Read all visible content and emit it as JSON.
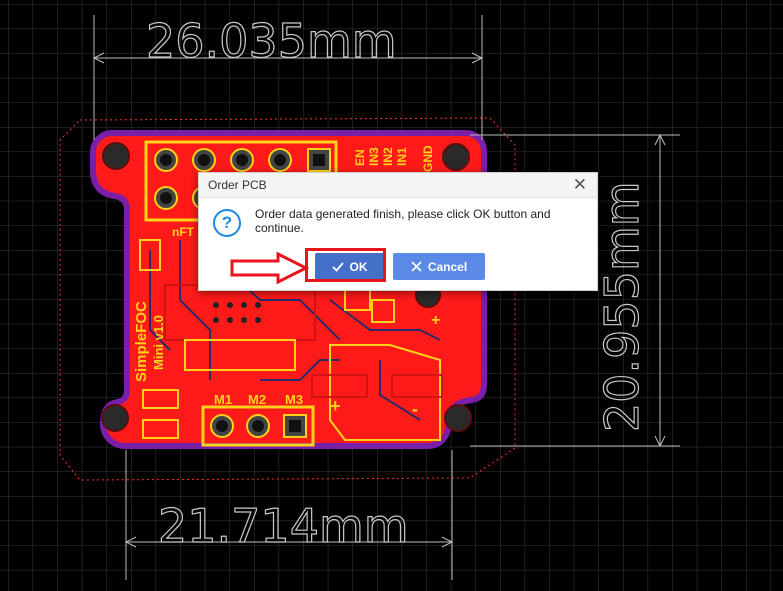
{
  "dimensions": {
    "top_width": "26.035mm",
    "bottom_width": "21.714mm",
    "right_height": "20.955mm"
  },
  "board": {
    "header_labels": [
      "EN",
      "IN3",
      "IN2",
      "IN1",
      "GND"
    ],
    "motor_labels": [
      "M1",
      "M2",
      "M3"
    ],
    "brand_line1": "SimpleFOC",
    "brand_line2": "Mini v1.0",
    "nfault_label": "nFT",
    "plus_sign": "+",
    "minus_sign": "-"
  },
  "dialog": {
    "title": "Order PCB",
    "close_icon": "close-icon",
    "question_icon": "question-icon",
    "question_glyph": "?",
    "message": "Order data generated finish, please click OK button and continue.",
    "ok_label": "OK",
    "cancel_label": "Cancel"
  },
  "colors": {
    "background": "#000000",
    "board": "#ff1a1a",
    "silkscreen": "#ffd21a",
    "outline": "#8a2be2",
    "ok_button": "#4470c9",
    "cancel_button": "#5b8ae6",
    "highlight": "#e8141e"
  }
}
